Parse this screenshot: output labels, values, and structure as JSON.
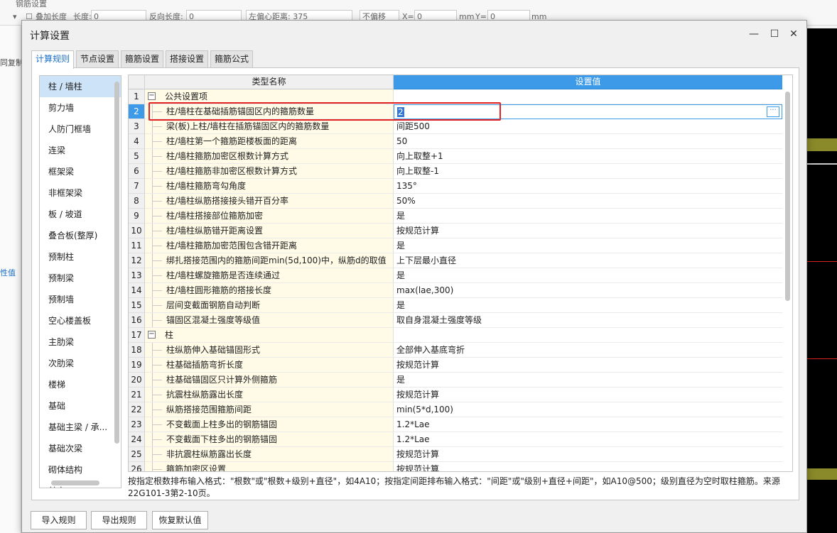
{
  "background": {
    "title_fragment": "钢筋设置",
    "toolbar_label_extra_length": "叠加长度",
    "toolbar_length_label": "长度:",
    "toolbar_length_value": "0",
    "toolbar_reverse_length_label": "反向长度:",
    "toolbar_reverse_length_value": "0",
    "toolbar_left_offset": "左偏心距离: 375",
    "toolbar_offset_select": "不偏移",
    "toolbar_x_label": "X=",
    "toolbar_x_value": "0",
    "toolbar_unit_x": "mm",
    "toolbar_y_label": "Y=",
    "toolbar_y_value": "0",
    "toolbar_unit_y": "mm",
    "left_copy_text": "同复制",
    "left_prop_text": "性值"
  },
  "dialog": {
    "title": "计算设置",
    "window_buttons": {
      "minimize": "—",
      "maximize": "☐",
      "close": "✕"
    },
    "tabs": [
      {
        "label": "计算规则",
        "active": true
      },
      {
        "label": "节点设置",
        "active": false
      },
      {
        "label": "箍筋设置",
        "active": false
      },
      {
        "label": "搭接设置",
        "active": false
      },
      {
        "label": "箍筋公式",
        "active": false
      }
    ],
    "categories": [
      {
        "label": "柱 / 墙柱",
        "selected": true
      },
      {
        "label": "剪力墙"
      },
      {
        "label": "人防门框墙"
      },
      {
        "label": "连梁"
      },
      {
        "label": "框架梁"
      },
      {
        "label": "非框架梁"
      },
      {
        "label": "板 / 坡道"
      },
      {
        "label": "叠合板(整厚)"
      },
      {
        "label": "预制柱"
      },
      {
        "label": "预制梁"
      },
      {
        "label": "预制墙"
      },
      {
        "label": "空心楼盖板"
      },
      {
        "label": "主肋梁"
      },
      {
        "label": "次肋梁"
      },
      {
        "label": "楼梯"
      },
      {
        "label": "基础"
      },
      {
        "label": "基础主梁 / 承..."
      },
      {
        "label": "基础次梁"
      },
      {
        "label": "砌体结构"
      },
      {
        "label": "其它"
      }
    ],
    "grid": {
      "header_name": "类型名称",
      "header_value": "设置值",
      "rows": [
        {
          "num": "1",
          "name": "公共设置项",
          "value": "",
          "group": true,
          "toggle": "−"
        },
        {
          "num": "2",
          "name": "柱/墙柱在基础插筋锚固区内的箍筋数量",
          "value": "2",
          "current": true
        },
        {
          "num": "3",
          "name": "梁(板)上柱/墙柱在插筋锚固区内的箍筋数量",
          "value": "间距500"
        },
        {
          "num": "4",
          "name": "柱/墙柱第一个箍筋距楼板面的距离",
          "value": "50"
        },
        {
          "num": "5",
          "name": "柱/墙柱箍筋加密区根数计算方式",
          "value": "向上取整+1"
        },
        {
          "num": "6",
          "name": "柱/墙柱箍筋非加密区根数计算方式",
          "value": "向上取整-1"
        },
        {
          "num": "7",
          "name": "柱/墙柱箍筋弯勾角度",
          "value": "135°"
        },
        {
          "num": "8",
          "name": "柱/墙柱纵筋搭接接头错开百分率",
          "value": "50%"
        },
        {
          "num": "9",
          "name": "柱/墙柱搭接部位箍筋加密",
          "value": "是"
        },
        {
          "num": "10",
          "name": "柱/墙柱纵筋错开距离设置",
          "value": "按规范计算"
        },
        {
          "num": "11",
          "name": "柱/墙柱箍筋加密范围包含错开距离",
          "value": "是"
        },
        {
          "num": "12",
          "name": "绑扎搭接范围内的箍筋间距min(5d,100)中，纵筋d的取值",
          "value": "上下层最小直径"
        },
        {
          "num": "13",
          "name": "柱/墙柱螺旋箍筋是否连续通过",
          "value": "是"
        },
        {
          "num": "14",
          "name": "柱/墙柱圆形箍筋的搭接长度",
          "value": "max(lae,300)"
        },
        {
          "num": "15",
          "name": "层间变截面钢筋自动判断",
          "value": "是"
        },
        {
          "num": "16",
          "name": "锚固区混凝土强度等级值",
          "value": "取自身混凝土强度等级"
        },
        {
          "num": "17",
          "name": "柱",
          "value": "",
          "group": true,
          "toggle": "−"
        },
        {
          "num": "18",
          "name": "柱纵筋伸入基础锚固形式",
          "value": "全部伸入基底弯折"
        },
        {
          "num": "19",
          "name": "柱基础插筋弯折长度",
          "value": "按规范计算"
        },
        {
          "num": "20",
          "name": "柱基础锚固区只计算外侧箍筋",
          "value": "是"
        },
        {
          "num": "21",
          "name": "抗震柱纵筋露出长度",
          "value": "按规范计算"
        },
        {
          "num": "22",
          "name": "纵筋搭接范围箍筋间距",
          "value": "min(5*d,100)"
        },
        {
          "num": "23",
          "name": "不变截面上柱多出的钢筋锚固",
          "value": "1.2*Lae"
        },
        {
          "num": "24",
          "name": "不变截面下柱多出的钢筋锚固",
          "value": "1.2*Lae"
        },
        {
          "num": "25",
          "name": "非抗震柱纵筋露出长度",
          "value": "按规范计算"
        },
        {
          "num": "26",
          "name": "箍筋加密区设置",
          "value": "按规范计算"
        }
      ],
      "ellipsis_label": "···"
    },
    "note": "按指定根数排布输入格式：\"根数\"或\"根数+级别+直径\"，如4A10；按指定间距排布输入格式：\"间距\"或\"级别+直径+间距\"，如A10@500；级别直径为空时取柱箍筋。来源22G101-3第2-10页。",
    "buttons": {
      "import": "导入规则",
      "export": "导出规则",
      "restore": "恢复默认值"
    }
  },
  "colors": {
    "accent": "#3d9ae8",
    "highlight": "#e32222",
    "name_cell_bg": "#fffbe7",
    "selected_category": "#cde3f7"
  }
}
